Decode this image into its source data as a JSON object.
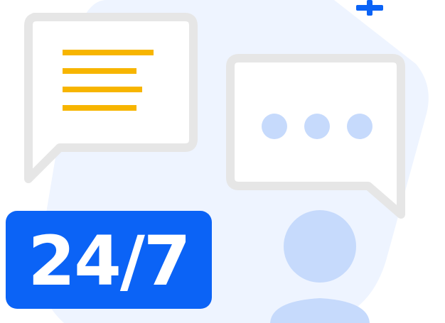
{
  "badge": {
    "text": "24/7"
  },
  "colors": {
    "background_blob": "#eef4ff",
    "bubble_outline": "#e6e6e6",
    "bubble_fill": "#ffffff",
    "text_lines": "#f7b500",
    "typing_dots": "#c6dafc",
    "badge_bg": "#0b63f6",
    "badge_text": "#ffffff",
    "person": "#c6dafc",
    "plus_mark": "#0b63f6"
  },
  "icons": {
    "left_bubble": "message-lines-icon",
    "right_bubble": "typing-dots-icon",
    "person": "user-icon",
    "plus": "plus-icon"
  }
}
